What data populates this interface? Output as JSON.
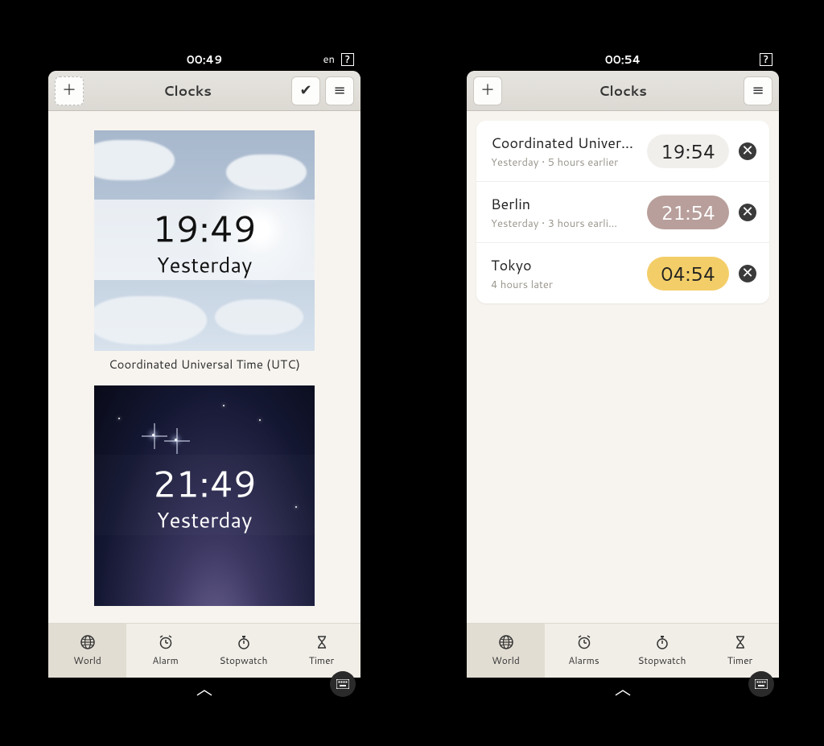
{
  "left": {
    "status_time": "00:49",
    "status_lang": "en",
    "header_title": "Clocks",
    "tile1": {
      "time": "19:49",
      "sub": "Yesterday",
      "caption": "Coordinated Universal Time (UTC)"
    },
    "tile2": {
      "time": "21:49",
      "sub": "Yesterday"
    },
    "tabs": {
      "world": "World",
      "alarm": "Alarm",
      "stopwatch": "Stopwatch",
      "timer": "Timer"
    }
  },
  "right": {
    "status_time": "00:54",
    "header_title": "Clocks",
    "rows": [
      {
        "city": "Coordinated Univer…",
        "desc": "Yesterday • 5 hours earlier",
        "time": "19:54",
        "pill": "neutral"
      },
      {
        "city": "Berlin",
        "desc": "Yesterday • 3 hours earli…",
        "time": "21:54",
        "pill": "dusk"
      },
      {
        "city": "Tokyo",
        "desc": "4 hours later",
        "time": "04:54",
        "pill": "day"
      }
    ],
    "tabs": {
      "world": "World",
      "alarms": "Alarms",
      "stopwatch": "Stopwatch",
      "timer": "Timer"
    }
  }
}
